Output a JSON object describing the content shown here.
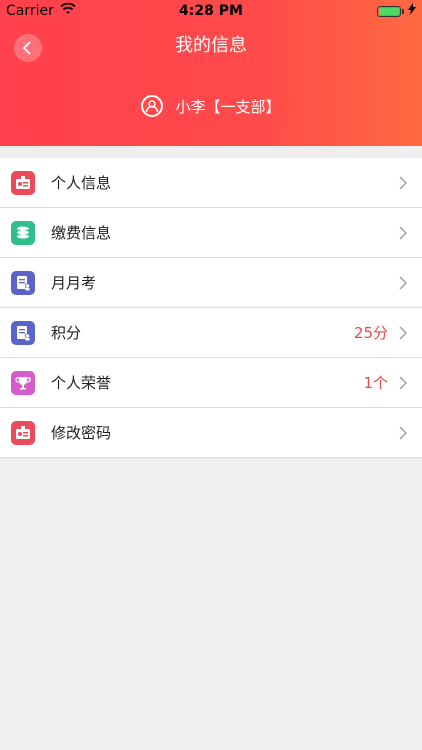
{
  "status": {
    "carrier": "Carrier",
    "time": "4:28 PM"
  },
  "header": {
    "title": "我的信息",
    "user": "小李【一支部】"
  },
  "menu": [
    {
      "label": "个人信息",
      "value": "",
      "icon": "id-card-icon",
      "color": "#e94b5a"
    },
    {
      "label": "缴费信息",
      "value": "",
      "icon": "coins-icon",
      "color": "#2fbf8a"
    },
    {
      "label": "月月考",
      "value": "",
      "icon": "exam-icon",
      "color": "#5a63c8"
    },
    {
      "label": "积分",
      "value": "25分",
      "icon": "points-icon",
      "color": "#5a63c8"
    },
    {
      "label": "个人荣誉",
      "value": "1个",
      "icon": "trophy-icon",
      "color": "#d45ccc"
    },
    {
      "label": "修改密码",
      "value": "",
      "icon": "lock-card-icon",
      "color": "#e94b5a"
    }
  ]
}
